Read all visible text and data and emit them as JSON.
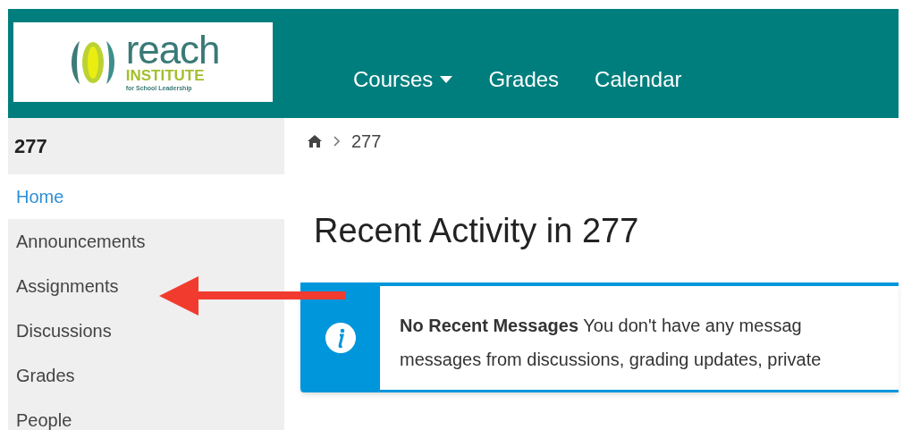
{
  "logo": {
    "name": "reach",
    "subtitle": "INSTITUTE",
    "tagline": "for School Leadership"
  },
  "nav": [
    {
      "label": "Courses",
      "dropdown": true
    },
    {
      "label": "Grades",
      "dropdown": false
    },
    {
      "label": "Calendar",
      "dropdown": false
    }
  ],
  "sidebar": {
    "title": "277",
    "items": [
      {
        "label": "Home",
        "selected": true
      },
      {
        "label": "Announcements",
        "selected": false
      },
      {
        "label": "Assignments",
        "selected": false
      },
      {
        "label": "Discussions",
        "selected": false
      },
      {
        "label": "Grades",
        "selected": false
      },
      {
        "label": "People",
        "selected": false
      }
    ]
  },
  "breadcrumb": [
    "277"
  ],
  "heading": "Recent Activity in 277",
  "alert": {
    "lines": [
      "**No Recent Messages**  You don't have any messag",
      "messages from discussions, grading updates, private"
    ]
  }
}
